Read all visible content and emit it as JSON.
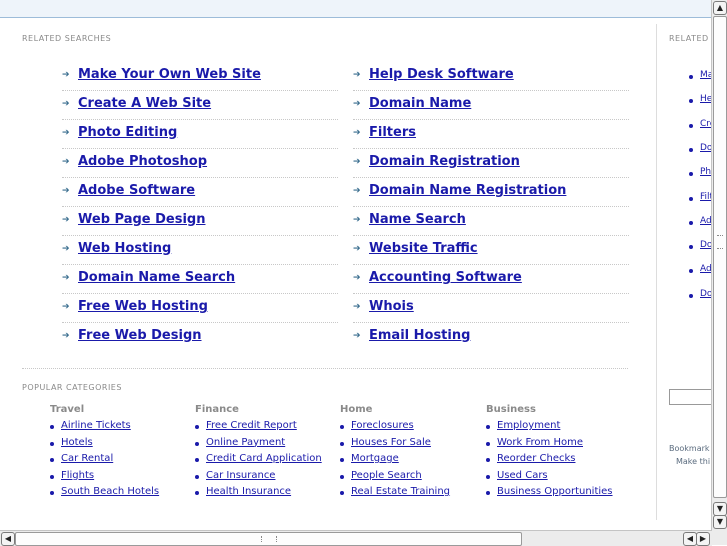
{
  "related_searches": {
    "label": "RELATED SEARCHES",
    "left": [
      "Make Your Own Web Site",
      "Create A Web Site",
      "Photo Editing",
      "Adobe Photoshop",
      "Adobe Software",
      "Web Page Design",
      "Web Hosting",
      "Domain Name Search",
      "Free Web Hosting",
      "Free Web Design"
    ],
    "right": [
      "Help Desk Software",
      "Domain Name",
      "Filters",
      "Domain Registration",
      "Domain Name Registration",
      "Name Search",
      "Website Traffic",
      "Accounting Software",
      "Whois",
      "Email Hosting"
    ]
  },
  "popular_categories": {
    "label": "POPULAR CATEGORIES",
    "columns": [
      {
        "title": "Travel",
        "items": [
          "Airline Tickets",
          "Hotels",
          "Car Rental",
          "Flights",
          "South Beach Hotels"
        ]
      },
      {
        "title": "Finance",
        "items": [
          "Free Credit Report",
          "Online Payment",
          "Credit Card Application",
          "Car Insurance",
          "Health Insurance"
        ]
      },
      {
        "title": "Home",
        "items": [
          "Foreclosures",
          "Houses For Sale",
          "Mortgage",
          "People Search",
          "Real Estate Training"
        ]
      },
      {
        "title": "Business",
        "items": [
          "Employment",
          "Work From Home",
          "Reorder Checks",
          "Used Cars",
          "Business Opportunities"
        ]
      }
    ]
  },
  "sidebar": {
    "label": "RELATED",
    "items": [
      "Ma",
      "He",
      "Cre",
      "Do",
      "Pho",
      "Filt",
      "Ad",
      "Do",
      "Ad",
      "Do"
    ],
    "note_line1": "Bookmark",
    "note_line2": "Make thi"
  },
  "scrollbars": {
    "up_arrow": "▲",
    "down_arrow": "▼",
    "left_arrow": "◀",
    "right_arrow": "▶"
  },
  "colors": {
    "link": "#1a1aaa",
    "arrow": "#3a6e8f",
    "label": "#8a8a8a"
  }
}
